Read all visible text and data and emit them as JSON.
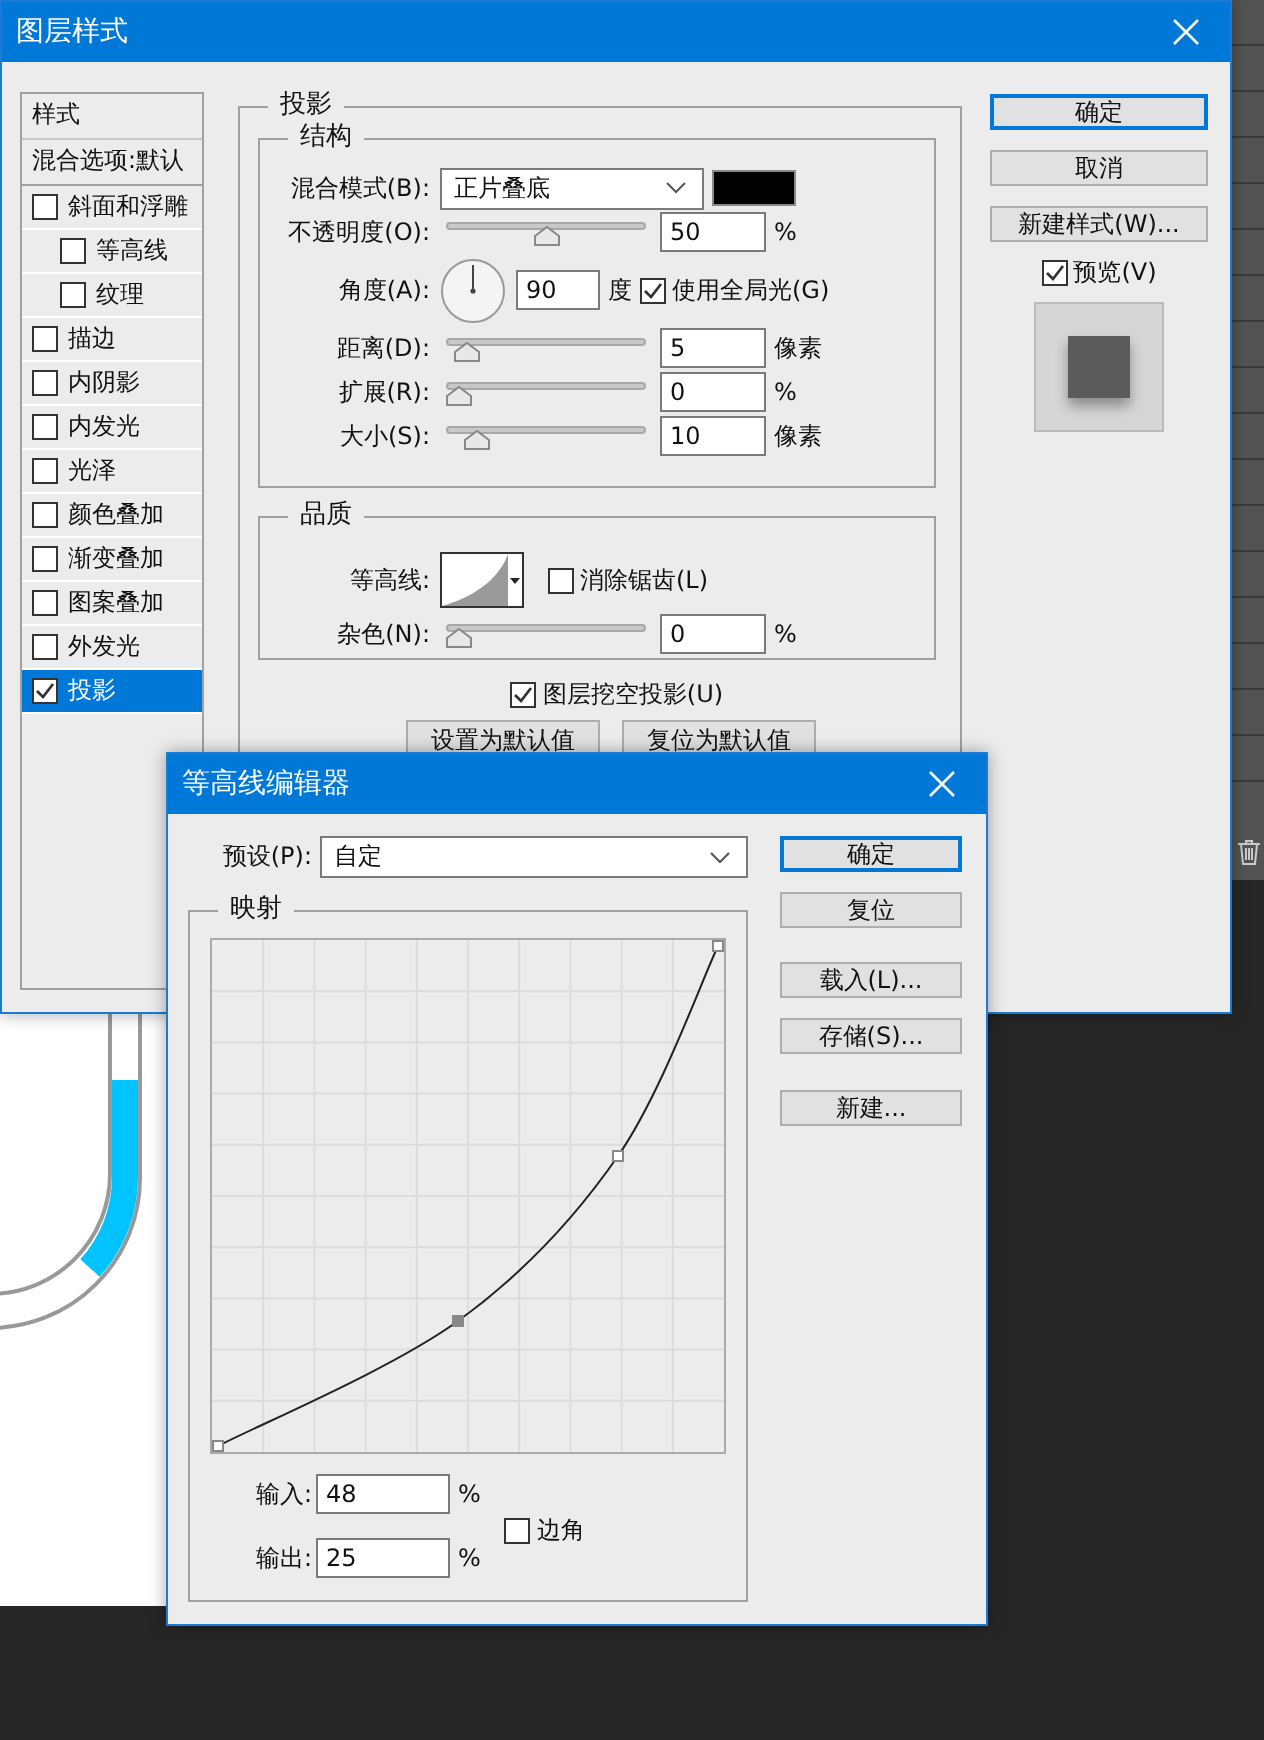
{
  "layer_style_dialog": {
    "title": "图层样式",
    "styles_header": "样式",
    "blending_options": "混合选项:默认",
    "effects": [
      {
        "label": "斜面和浮雕",
        "checked": false,
        "selected": false,
        "children": [
          {
            "label": "等高线",
            "checked": false,
            "selected": false
          },
          {
            "label": "纹理",
            "checked": false,
            "selected": false
          }
        ]
      },
      {
        "label": "描边",
        "checked": false,
        "selected": false
      },
      {
        "label": "内阴影",
        "checked": false,
        "selected": false
      },
      {
        "label": "内发光",
        "checked": false,
        "selected": false
      },
      {
        "label": "光泽",
        "checked": false,
        "selected": false
      },
      {
        "label": "颜色叠加",
        "checked": false,
        "selected": false
      },
      {
        "label": "渐变叠加",
        "checked": false,
        "selected": false
      },
      {
        "label": "图案叠加",
        "checked": false,
        "selected": false
      },
      {
        "label": "外发光",
        "checked": false,
        "selected": false
      },
      {
        "label": "投影",
        "checked": true,
        "selected": true
      }
    ],
    "drop_shadow": {
      "title": "投影",
      "structure": {
        "title": "结构",
        "blend_mode": {
          "label": "混合模式(B):",
          "value": "正片叠底"
        },
        "rows": [
          {
            "kind": "slider",
            "label": "不透明度(O):",
            "level": 0.5,
            "value": "50",
            "unit": "%"
          },
          {
            "kind": "angle",
            "label": "角度(A):",
            "value": "90",
            "unit": "度",
            "global_light": {
              "label": "使用全局光(G)",
              "checked": true
            }
          },
          {
            "kind": "slider",
            "label": "距离(D):",
            "level": 0.05,
            "value": "5",
            "unit": "像素"
          },
          {
            "kind": "slider",
            "label": "扩展(R):",
            "level": 0,
            "value": "0",
            "unit": "%"
          },
          {
            "kind": "slider",
            "label": "大小(S):",
            "level": 0.1,
            "value": "10",
            "unit": "像素"
          }
        ]
      },
      "quality": {
        "title": "品质",
        "contour": {
          "label": "等高线:"
        },
        "anti_alias": {
          "label": "消除锯齿(L)",
          "checked": false
        },
        "noise": {
          "label": "杂色(N):",
          "level": 0,
          "value": "0",
          "unit": "%"
        }
      },
      "knockout": {
        "label": "图层挖空投影(U)",
        "checked": true
      },
      "buttons": [
        "设置为默认值",
        "复位为默认值"
      ]
    },
    "buttons": [
      {
        "label": "确定",
        "default": true
      },
      {
        "label": "取消",
        "default": false
      },
      {
        "label": "新建样式(W)...",
        "default": false
      }
    ],
    "preview": {
      "label": "预览(V)",
      "checked": true
    }
  },
  "contour_editor": {
    "title": "等高线编辑器",
    "preset": {
      "label": "预设(P):",
      "value": "自定"
    },
    "buttons": [
      {
        "label": "确定",
        "default": true
      },
      {
        "label": "复位",
        "default": false
      },
      {
        "label": "载入(L)...",
        "default": false
      },
      {
        "label": "存储(S)...",
        "default": false
      },
      {
        "label": "新建...",
        "default": false
      }
    ],
    "mapping": {
      "title": "映射",
      "input": {
        "label": "输入:",
        "value": "48",
        "unit": "%"
      },
      "output": {
        "label": "输出:",
        "value": "25",
        "unit": "%"
      },
      "corner": {
        "label": "边角",
        "checked": false
      }
    }
  }
}
